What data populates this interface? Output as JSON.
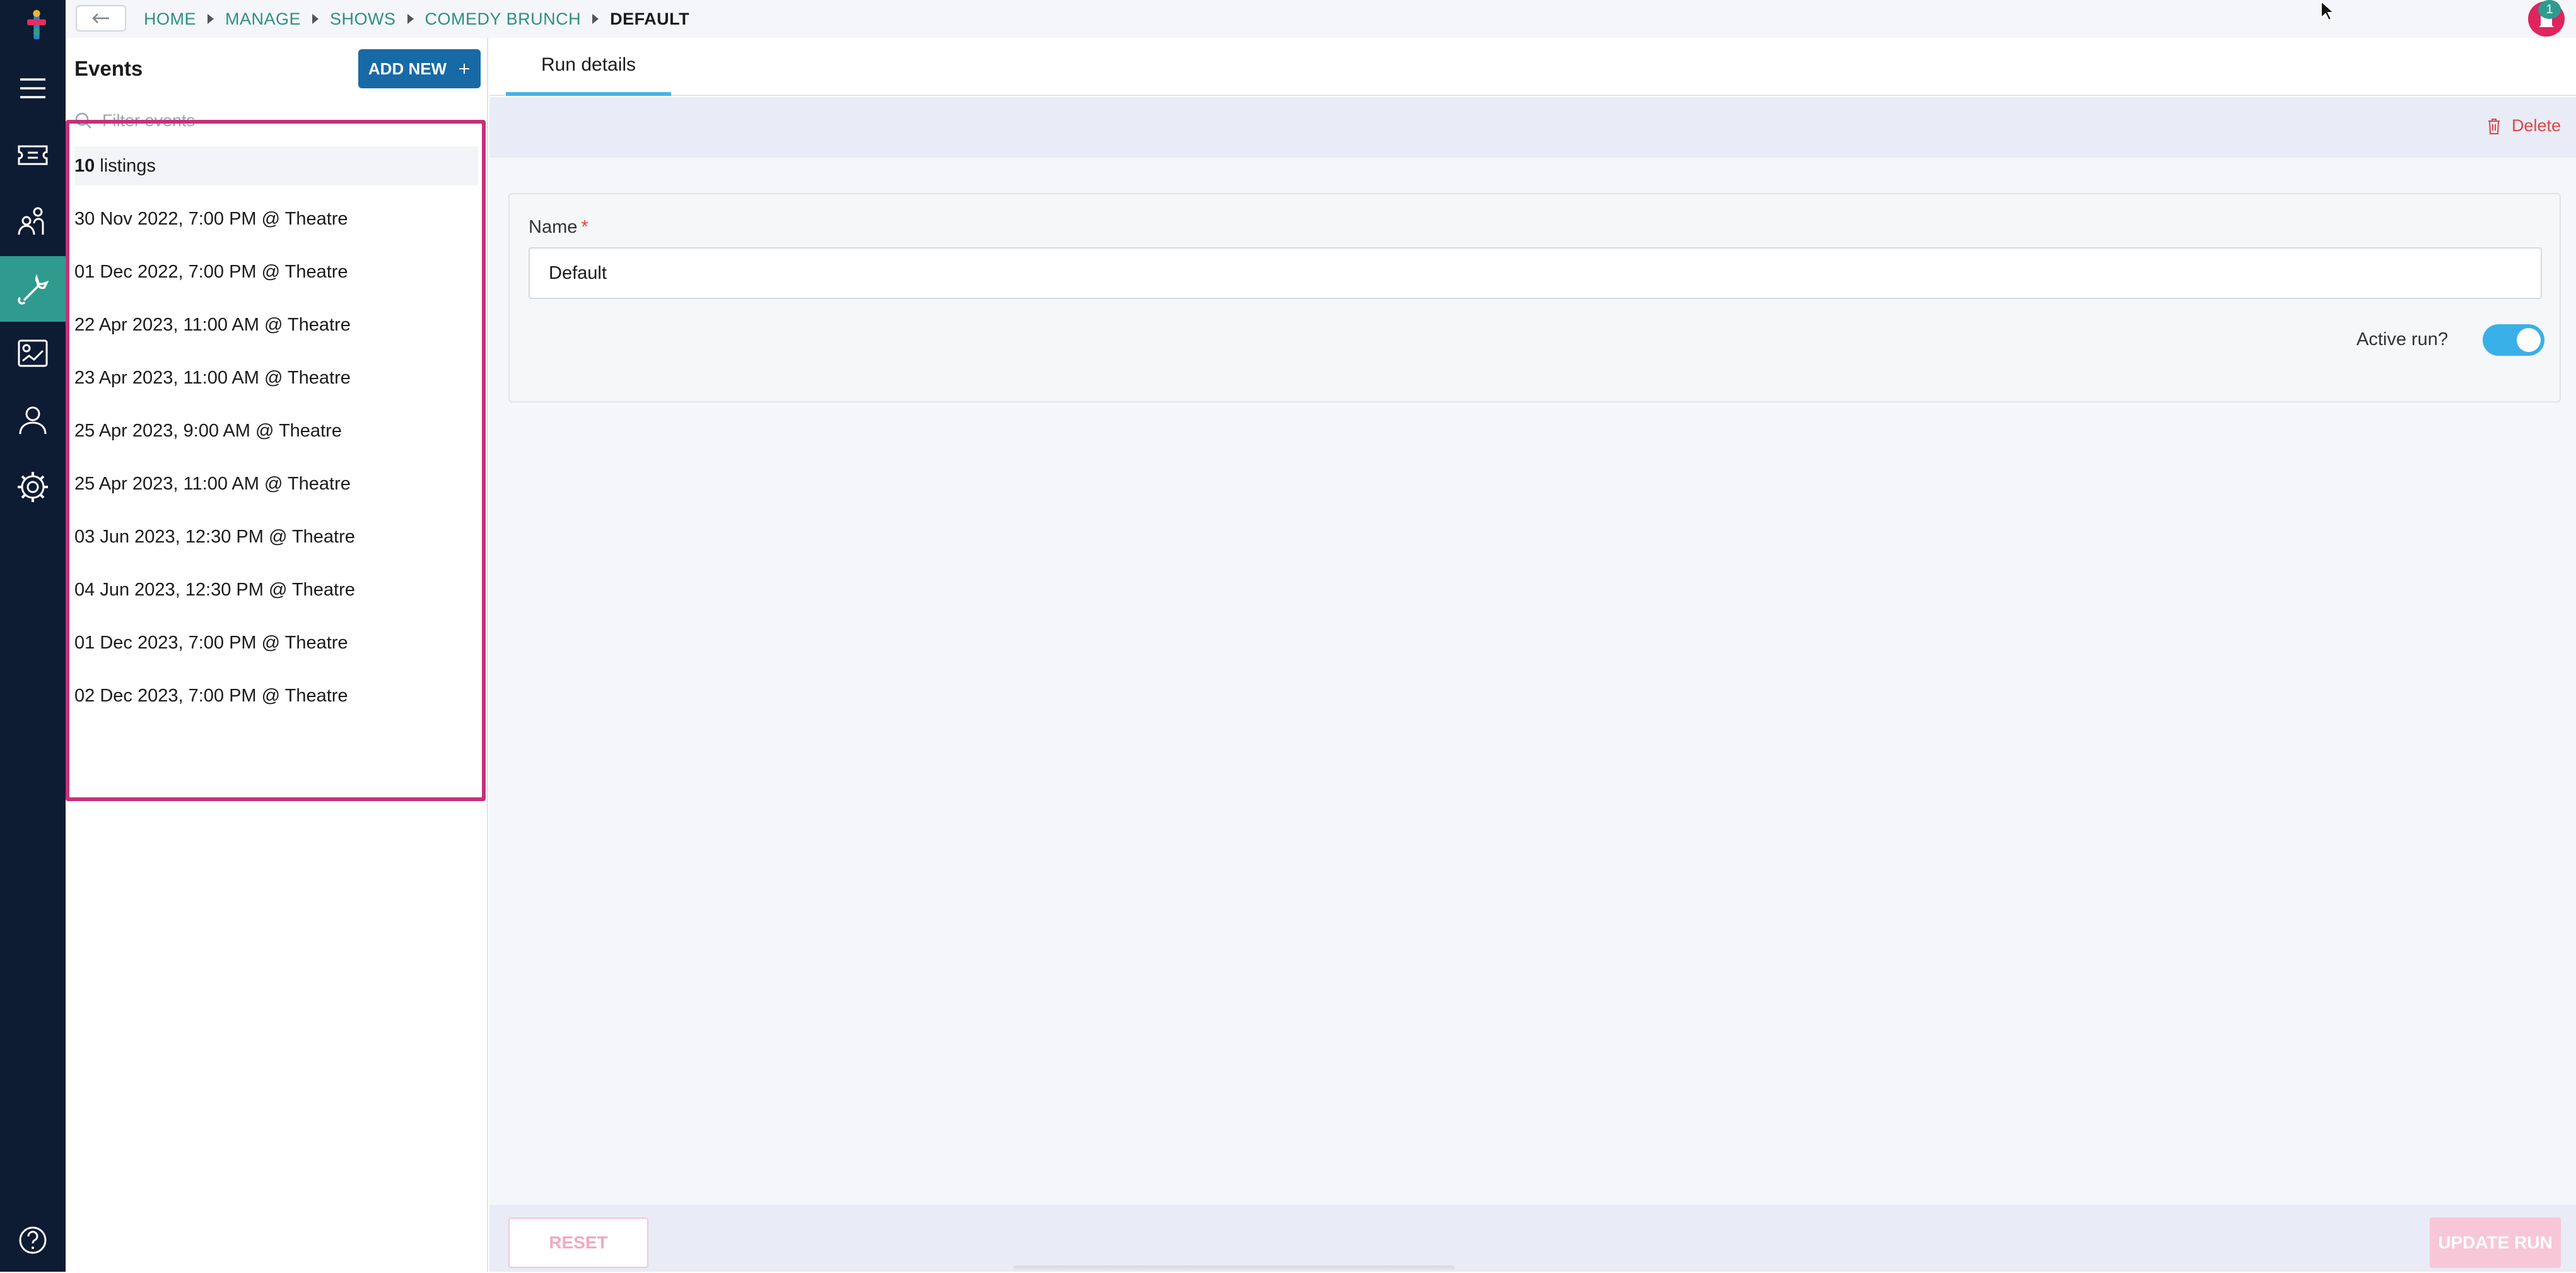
{
  "breadcrumb": {
    "items": [
      "HOME",
      "MANAGE",
      "SHOWS",
      "COMEDY BRUNCH"
    ],
    "current": "DEFAULT"
  },
  "notifications": {
    "count": "1"
  },
  "events_panel": {
    "title": "Events",
    "add_new_label": "ADD NEW",
    "filter_placeholder": "Filter events",
    "listings_count": "10",
    "listings_label": "listings",
    "events": [
      "30 Nov 2022, 7:00 PM @ Theatre",
      "01 Dec 2022, 7:00 PM @ Theatre",
      "22 Apr 2023, 11:00 AM @ Theatre",
      "23 Apr 2023, 11:00 AM @ Theatre",
      "25 Apr 2023, 9:00 AM @ Theatre",
      "25 Apr 2023, 11:00 AM @ Theatre",
      "03 Jun 2023, 12:30 PM @ Theatre",
      "04 Jun 2023, 12:30 PM @ Theatre",
      "01 Dec 2023, 7:00 PM @ Theatre",
      "02 Dec 2023, 7:00 PM @ Theatre"
    ]
  },
  "tabs": {
    "run_details": "Run details"
  },
  "actions": {
    "delete_label": "Delete"
  },
  "form": {
    "name_label": "Name",
    "required_marker": "*",
    "name_value": "Default",
    "active_label": "Active run?",
    "active_value": true
  },
  "footer": {
    "reset_label": "RESET",
    "update_label": "UPDATE RUN"
  },
  "colors": {
    "rail": "#0d1b33",
    "rail_active": "#2f9b8f",
    "primary_button": "#176aa6",
    "highlight_border": "#c6307b",
    "tab_underline": "#46b3e6",
    "toggle_on": "#3ab0e8",
    "danger": "#e04545"
  },
  "icons": {
    "rail": [
      "logo-icon",
      "menu-icon",
      "tickets-icon",
      "audience-icon",
      "tools-icon",
      "reports-icon",
      "user-icon",
      "settings-icon",
      "help-icon"
    ]
  }
}
